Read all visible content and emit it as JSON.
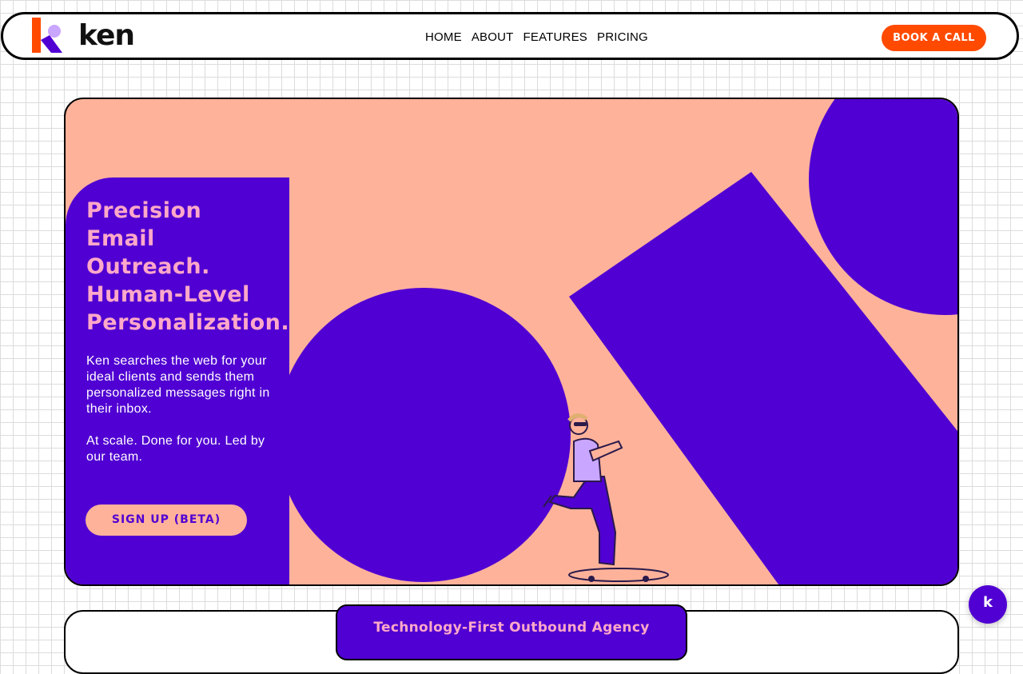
{
  "brand": {
    "name": "ken",
    "logo_orange": "#ff4a00",
    "logo_purple": "#5000d2",
    "logo_lilac": "#c9a6ff"
  },
  "nav": {
    "items": [
      {
        "label": "HOME"
      },
      {
        "label": "ABOUT"
      },
      {
        "label": "FEATURES"
      },
      {
        "label": "PRICING"
      }
    ],
    "cta_label": "BOOK A CALL"
  },
  "hero": {
    "title_lines": [
      "Precision",
      "Email",
      "Outreach.",
      "Human-Level",
      "Personalization."
    ],
    "body_1": "Ken searches the web for your ideal clients and sends them personalized messages right in their inbox.",
    "body_2": "At scale. Done for you. Led by our team.",
    "signup_label": "SIGN UP (BETA)"
  },
  "section2": {
    "tab_label": "Technology-First Outbound Agency"
  },
  "chat": {
    "icon": "k"
  },
  "colors": {
    "purple": "#5000d2",
    "peach": "#ffb29a",
    "pink": "#ffa8c9",
    "orange": "#ff4a00"
  }
}
